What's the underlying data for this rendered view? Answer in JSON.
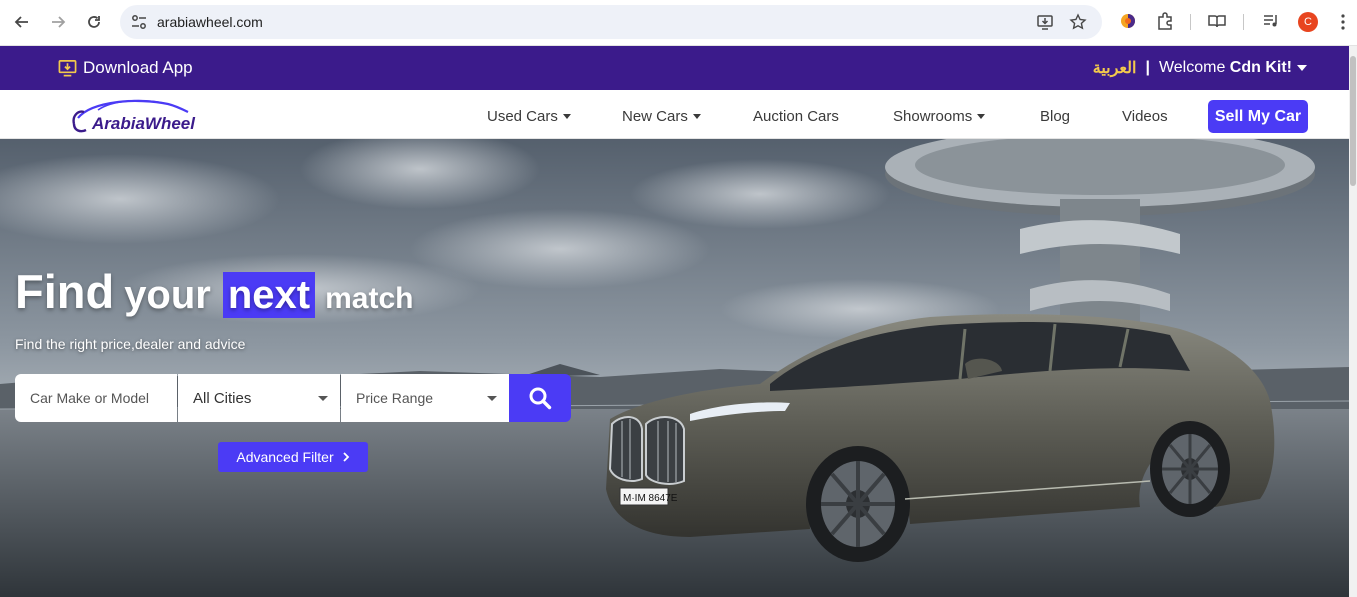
{
  "browser": {
    "url": "arabiawheel.com",
    "profile_initial": "C"
  },
  "topbar": {
    "download_label": "Download App",
    "language_label": "العربية",
    "separator": "|",
    "welcome_prefix": "Welcome ",
    "welcome_user": "Cdn Kit!"
  },
  "brand": {
    "logo_text": "ArabiaWheel",
    "primary_color": "#3b1b8b",
    "accent_color": "#4b3bf5"
  },
  "nav": {
    "items": [
      {
        "label": "Used Cars",
        "has_dropdown": true
      },
      {
        "label": "New Cars",
        "has_dropdown": true
      },
      {
        "label": "Auction Cars",
        "has_dropdown": false
      },
      {
        "label": "Showrooms",
        "has_dropdown": true
      },
      {
        "label": "Blog",
        "has_dropdown": false
      },
      {
        "label": "Videos",
        "has_dropdown": false
      }
    ],
    "cta_label": "Sell My Car"
  },
  "hero": {
    "headline": {
      "w1": "Find",
      "w2": "your",
      "w3": "next",
      "w4": "match"
    },
    "subtitle": "Find the right price,dealer and advice",
    "search": {
      "make_placeholder": "Car Make or Model",
      "city_value": "All Cities",
      "price_value": "Price Range"
    },
    "advanced_filter_label": "Advanced Filter",
    "plate_text": "M·IM 8647E"
  }
}
